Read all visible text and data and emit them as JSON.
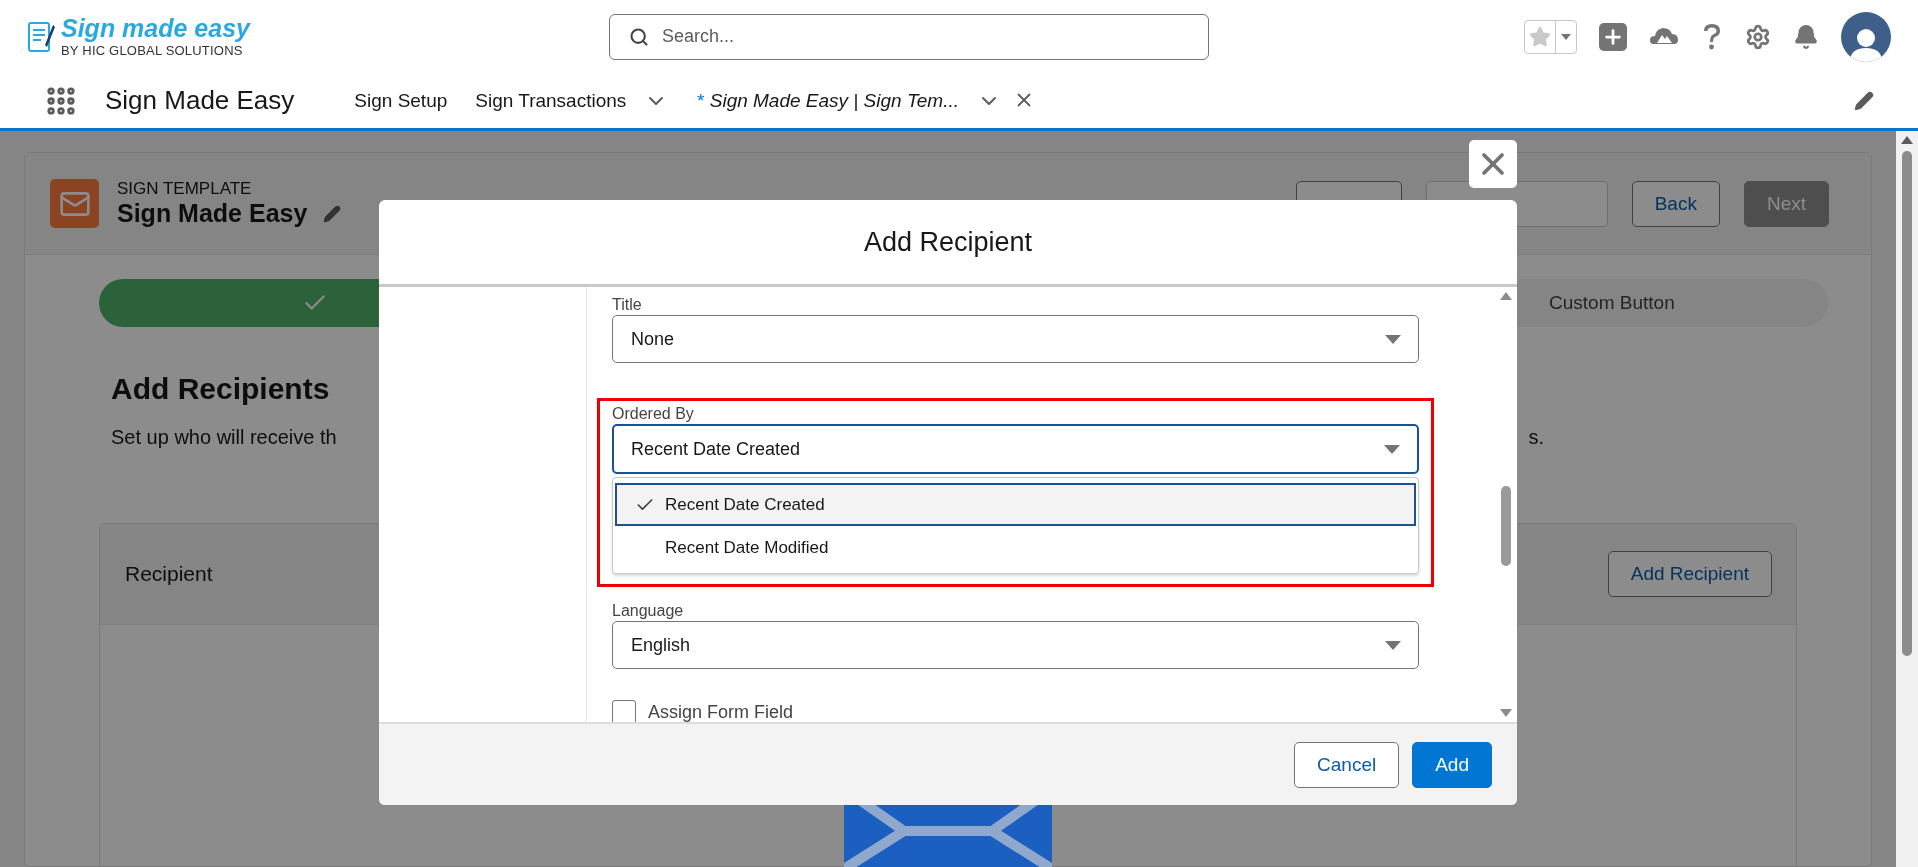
{
  "header": {
    "logo": {
      "name": "Sign made easy",
      "tagline": "BY HIC GLOBAL SOLUTIONS"
    },
    "search": {
      "placeholder": "Search..."
    }
  },
  "nav": {
    "app_name": "Sign Made Easy",
    "tabs": [
      {
        "label": "Sign Setup",
        "selected": false,
        "has_menu": false,
        "closable": false
      },
      {
        "label": "Sign Transactions",
        "selected": false,
        "has_menu": true,
        "closable": false
      },
      {
        "label": "Sign Made Easy | Sign Tem...",
        "marker": "*",
        "selected": true,
        "has_menu": true,
        "closable": true
      }
    ]
  },
  "record": {
    "object_type": "SIGN TEMPLATE",
    "title": "Sign Made Easy",
    "buttons": [
      {
        "disabled": false
      },
      {
        "disabled": true
      },
      {
        "label": "Back",
        "disabled": false
      },
      {
        "label": "Next",
        "disabled": true
      }
    ]
  },
  "path": {
    "steps": [
      {
        "complete": true
      },
      {
        "label": "Custom Button",
        "complete": false
      }
    ]
  },
  "section": {
    "heading": "Add Recipients",
    "description_start": "Set up who will receive th",
    "description_end": "s."
  },
  "recipient_card": {
    "title": "Recipient",
    "button": "Add Recipient"
  },
  "modal": {
    "title": "Add Recipient",
    "fields": [
      {
        "kind": "select",
        "label": "Title",
        "value": "None",
        "focused": false,
        "highlighted": false
      },
      {
        "kind": "select",
        "label": "Ordered By",
        "value": "Recent Date Created",
        "focused": true,
        "highlighted": true,
        "options": [
          {
            "label": "Recent Date Created",
            "selected": true
          },
          {
            "label": "Recent Date Modified",
            "selected": false
          }
        ]
      },
      {
        "kind": "select",
        "label": "Language",
        "value": "English",
        "focused": false,
        "highlighted": false
      },
      {
        "kind": "checkbox",
        "label": "Assign Form Field",
        "checked": false
      }
    ],
    "buttons": [
      {
        "label": "Cancel",
        "kind": "neutral"
      },
      {
        "label": "Add",
        "kind": "brand"
      }
    ]
  }
}
